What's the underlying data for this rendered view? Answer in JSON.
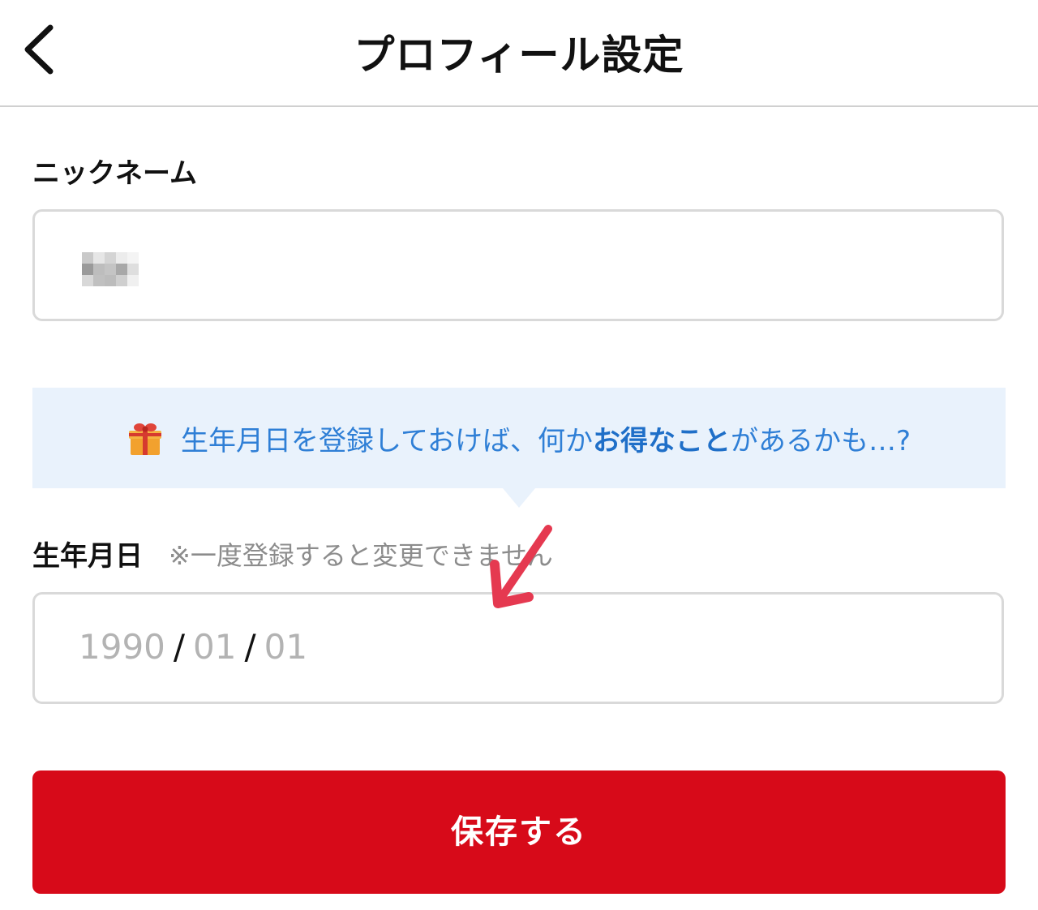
{
  "header": {
    "title": "プロフィール設定",
    "back_icon": "chevron-left-icon"
  },
  "nickname": {
    "label": "ニックネーム",
    "value_obscured": true
  },
  "promo": {
    "icon": "gift-icon",
    "text_part1": "生年月日を登録しておけば、何か",
    "text_bold": "お得なこと",
    "text_part2": "があるかも…?"
  },
  "birthdate": {
    "label": "生年月日",
    "note": "※一度登録すると変更できません",
    "year_placeholder": "1990",
    "month_placeholder": "01",
    "day_placeholder": "01",
    "separator": "/"
  },
  "annotation": {
    "icon": "arrow-down-left-icon",
    "color": "#e53950"
  },
  "actions": {
    "save_label": "保存する"
  },
  "colors": {
    "accent": "#d70a19",
    "promo_bg": "#e9f2fc",
    "promo_text": "#2f7fd6"
  }
}
